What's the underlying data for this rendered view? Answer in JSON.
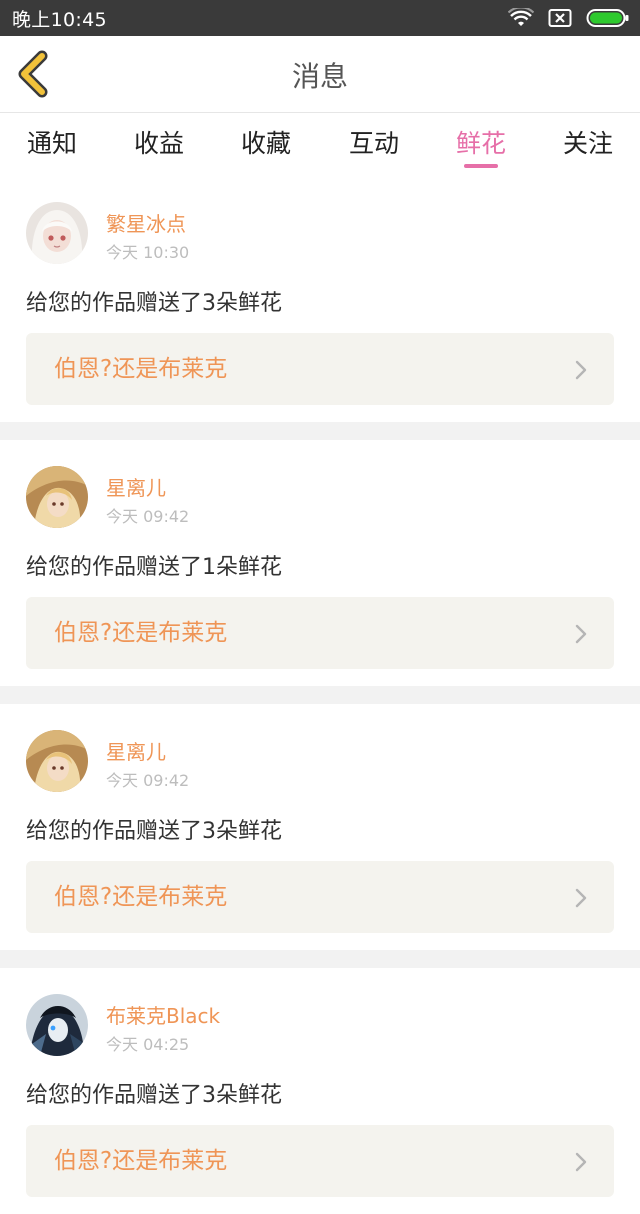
{
  "status_bar": {
    "time": "晚上10:45",
    "icons": [
      "wifi-icon",
      "sim-card-icon",
      "battery-icon"
    ]
  },
  "nav": {
    "back_icon": "chevron-left-icon",
    "title": "消息",
    "accent_color": "#f2c23a"
  },
  "tabs": [
    {
      "label": "通知",
      "active": false
    },
    {
      "label": "收益",
      "active": false
    },
    {
      "label": "收藏",
      "active": false
    },
    {
      "label": "互动",
      "active": false
    },
    {
      "label": "鲜花",
      "active": true
    },
    {
      "label": "关注",
      "active": false
    }
  ],
  "colors": {
    "active_tab": "#e66fa8",
    "username": "#ef9556",
    "link_bg": "#f4f3ee"
  },
  "messages": [
    {
      "username": "繁星冰点",
      "time": "今天 10:30",
      "text": "给您的作品赠送了3朵鲜花",
      "work_title": "伯恩?还是布莱克",
      "avatar": "avatar-white-hair"
    },
    {
      "username": "星离儿",
      "time": "今天 09:42",
      "text": "给您的作品赠送了1朵鲜花",
      "work_title": "伯恩?还是布莱克",
      "avatar": "avatar-gold-hair"
    },
    {
      "username": "星离儿",
      "time": "今天 09:42",
      "text": "给您的作品赠送了3朵鲜花",
      "work_title": "伯恩?还是布莱克",
      "avatar": "avatar-gold-hair"
    },
    {
      "username": "布莱克Black",
      "time": "今天 04:25",
      "text": "给您的作品赠送了3朵鲜花",
      "work_title": "伯恩?还是布莱克",
      "avatar": "avatar-dark-blue"
    }
  ]
}
